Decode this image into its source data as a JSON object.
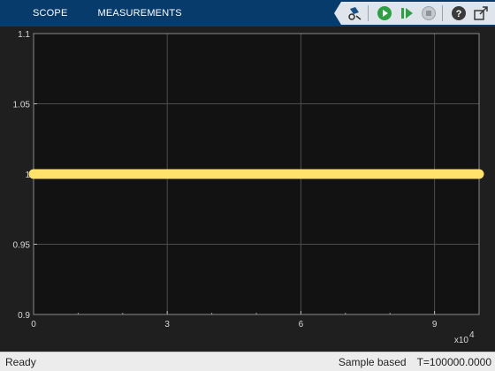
{
  "toolstrip": {
    "tabs": [
      {
        "label": "SCOPE"
      },
      {
        "label": "MEASUREMENTS"
      }
    ],
    "buttons": [
      {
        "icon": "highlight-signal-icon"
      },
      {
        "icon": "run-icon"
      },
      {
        "icon": "step-forward-icon"
      },
      {
        "icon": "stop-icon"
      },
      {
        "icon": "help-icon"
      },
      {
        "icon": "undock-icon"
      }
    ]
  },
  "chart_data": {
    "type": "line",
    "title": "",
    "xlabel": "",
    "ylabel": "",
    "x_multiplier_label": "x10",
    "x_multiplier_exponent": "4",
    "xlim": [
      0,
      10
    ],
    "ylim": [
      0.9,
      1.1
    ],
    "x_ticks": [
      "0",
      "3",
      "6",
      "9"
    ],
    "x_tick_values": [
      0,
      3,
      6,
      9
    ],
    "y_ticks": [
      "0.9",
      "0.95",
      "1",
      "1.05",
      "1.1"
    ],
    "y_tick_values": [
      0.9,
      0.95,
      1.0,
      1.05,
      1.1
    ],
    "grid": true,
    "series": [
      {
        "color": "#ffe26b",
        "x": [
          0,
          10
        ],
        "y": [
          1,
          1
        ]
      }
    ]
  },
  "status": {
    "left": "Ready",
    "mode": "Sample based",
    "time": "T=100000.0000"
  },
  "colors": {
    "toolstrip_bg": "#073b6b",
    "plot_bg": "#121212",
    "grid": "#4d4d4d",
    "signal": "#ffe26b"
  }
}
